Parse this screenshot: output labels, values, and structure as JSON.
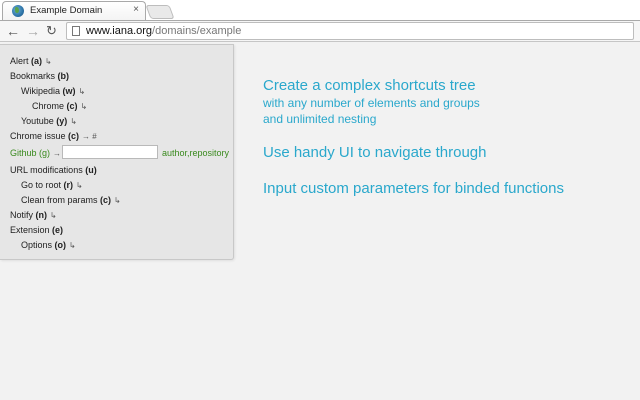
{
  "browser": {
    "tab_title": "Example Domain",
    "tab_close": "×",
    "url_host": "www.iana.org",
    "url_path": "/domains/example",
    "icons": {
      "back": "back-arrow-icon",
      "forward": "forward-arrow-icon",
      "reload": "reload-icon",
      "page": "page-icon",
      "favicon": "globe-favicon-icon"
    }
  },
  "menu": {
    "items": [
      {
        "label": "Alert ",
        "key": "(a)",
        "arrow": "↳"
      },
      {
        "label": "Bookmarks ",
        "key": "(b)",
        "arrow": ""
      },
      {
        "label": "Wikipedia ",
        "key": "(w)",
        "arrow": "↳"
      },
      {
        "label": "Chrome ",
        "key": "(c)",
        "arrow": "↳"
      },
      {
        "label": "Youtube ",
        "key": "(y)",
        "arrow": "↳"
      },
      {
        "label": "Chrome issue ",
        "key": "(c)",
        "arrow": "→ #"
      },
      {
        "label": "Github ",
        "key": "(g)",
        "arrow": "→"
      },
      {
        "label": "URL modifications ",
        "key": "(u)",
        "arrow": ""
      },
      {
        "label": "Go to root ",
        "key": "(r)",
        "arrow": "↳"
      },
      {
        "label": "Clean from params ",
        "key": "(c)",
        "arrow": "↳"
      },
      {
        "label": "Notify ",
        "key": "(n)",
        "arrow": "↳"
      },
      {
        "label": "Extension ",
        "key": "(e)",
        "arrow": ""
      },
      {
        "label": "Options ",
        "key": "(o)",
        "arrow": "↳"
      }
    ],
    "github_input_value": "",
    "github_hint": "author,repository",
    "colors": {
      "highlight": "#3a8a1e",
      "panel_bg": "#e6e6e6"
    }
  },
  "promo": {
    "line1": "Create a complex shortcuts tree",
    "line2": "with any number of elements and groups",
    "line3": "and unlimited nesting",
    "line4": "Use handy UI to navigate through",
    "line5": "Input custom parameters for binded functions",
    "color": "#2aa8cc"
  }
}
